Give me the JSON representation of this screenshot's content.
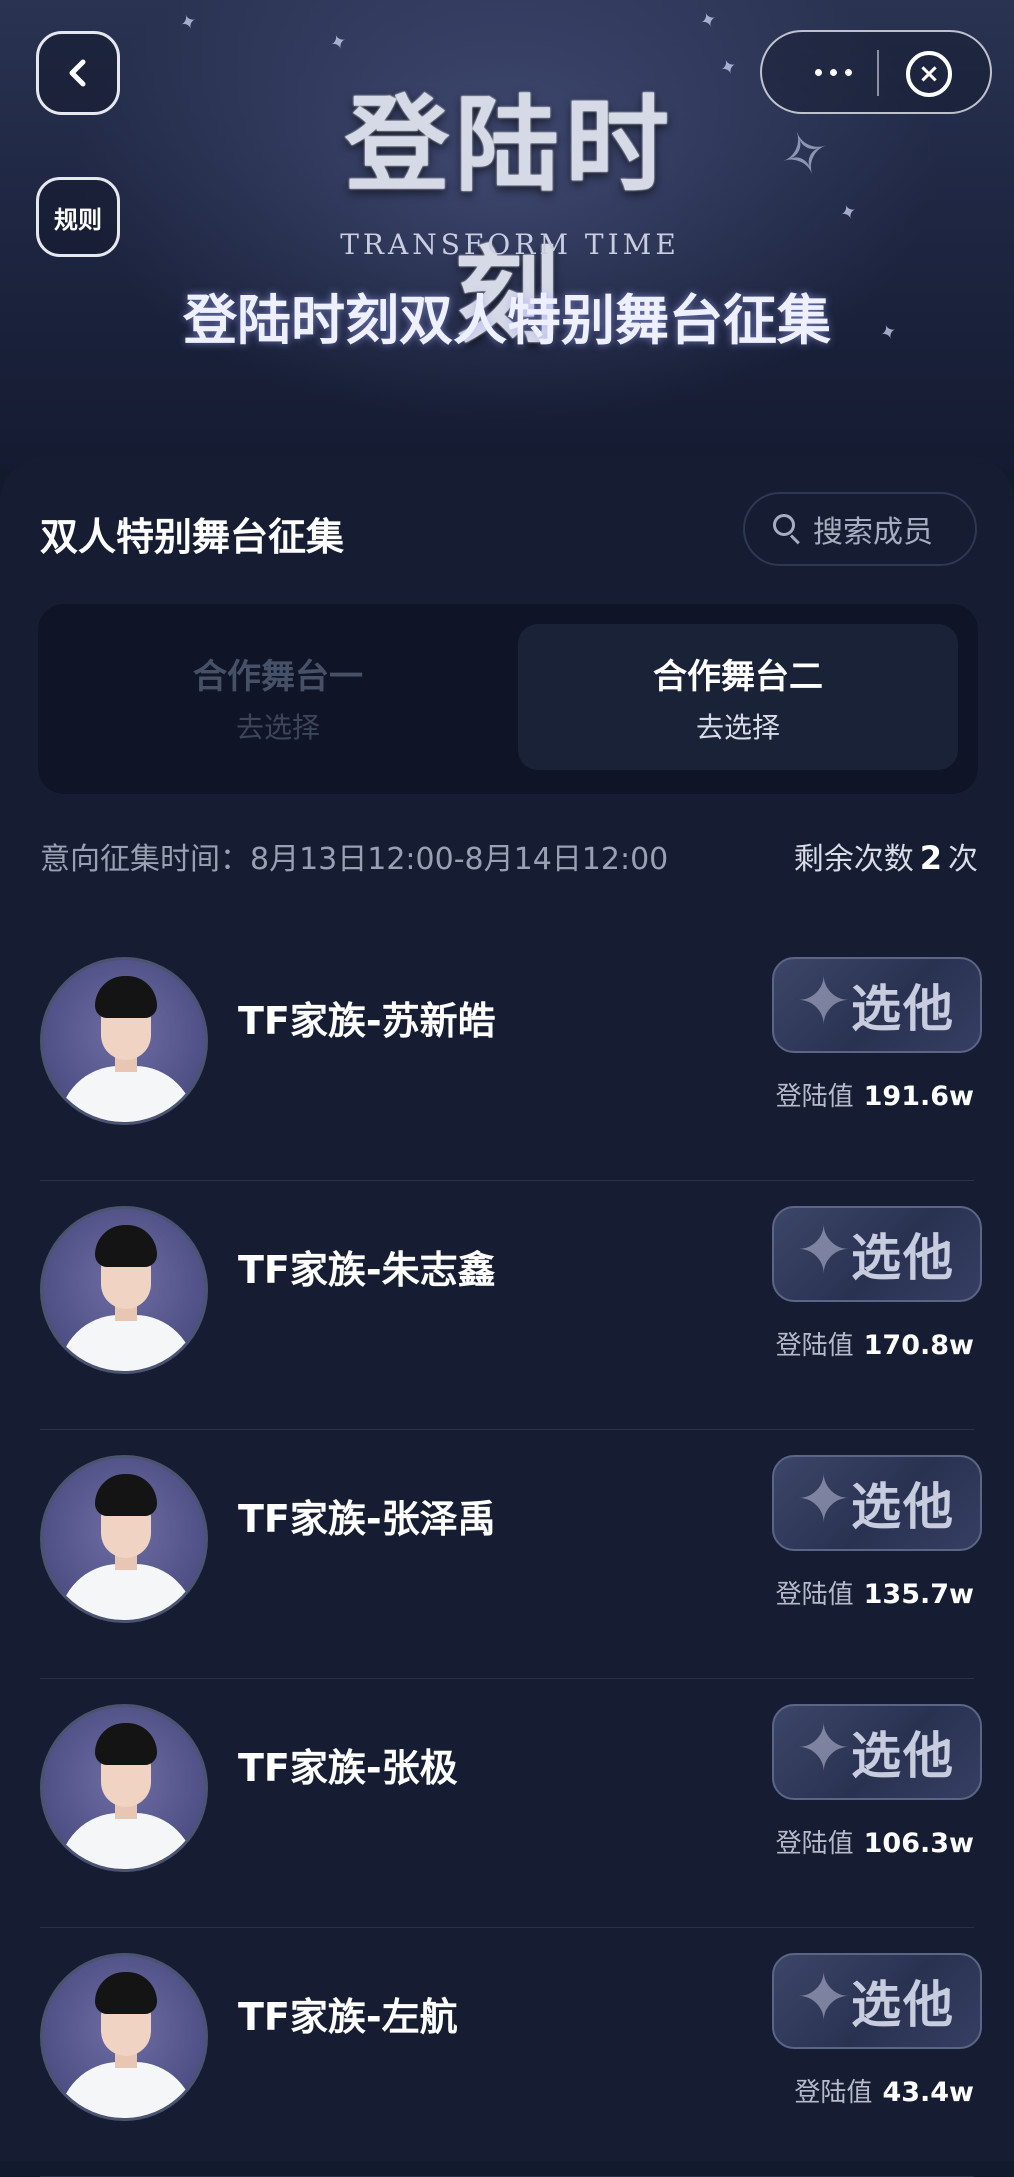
{
  "header": {
    "back_icon": "chevron-left-icon",
    "rules_label": "规则",
    "more_icon": "more-dots-icon",
    "close_icon": "close-circle-icon",
    "logo_title": "登陆时刻",
    "logo_subtitle": "TRANSFORM TIME",
    "banner_title": "登陆时刻双人特别舞台征集"
  },
  "section": {
    "title": "双人特别舞台征集",
    "search_placeholder": "搜索成员",
    "search_icon": "search-icon"
  },
  "tabs": [
    {
      "name": "合作舞台一",
      "action": "去选择",
      "active": false
    },
    {
      "name": "合作舞台二",
      "action": "去选择",
      "active": true
    }
  ],
  "info": {
    "time_label": "意向征集时间：8月13日12:00-8月14日12:00",
    "remaining_prefix": "剩余次数",
    "remaining_count": "2",
    "remaining_suffix": "次"
  },
  "members": [
    {
      "name": "TF家族-苏新皓",
      "button": "选他",
      "score_label": "登陆值",
      "score": "191.6w"
    },
    {
      "name": "TF家族-朱志鑫",
      "button": "选他",
      "score_label": "登陆值",
      "score": "170.8w"
    },
    {
      "name": "TF家族-张泽禹",
      "button": "选他",
      "score_label": "登陆值",
      "score": "135.7w"
    },
    {
      "name": "TF家族-张极",
      "button": "选他",
      "score_label": "登陆值",
      "score": "106.3w"
    },
    {
      "name": "TF家族-左航",
      "button": "选他",
      "score_label": "登陆值",
      "score": "43.4w"
    }
  ],
  "colors": {
    "background": "#161d32",
    "tab_active": "#1a2238",
    "button_gradient_start": "#3c4668"
  }
}
